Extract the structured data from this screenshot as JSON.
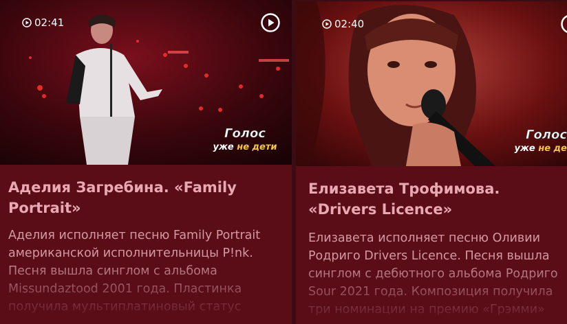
{
  "cards": [
    {
      "duration": "02:41",
      "title": "Аделия Загребина. «Family Portrait»",
      "description": "Аделия исполняет песню Family Portrait американской исполнительницы P!nk. Песня вышла синглом с альбома Missundaztood 2001 года. Пластинка получила мультиплатиновый статус",
      "logo_line1": "Голос",
      "logo_line2a": "уже ",
      "logo_line2b": "не дети"
    },
    {
      "duration": "02:40",
      "title": "Елизавета Трофимова. «Drivers Licence»",
      "description": "Елизавета исполняет песню Оливии Родриго Drivers Licence. Песня вышла синглом с дебютного альбома Родриго Sour 2021 года. Композиция получила три номинации на премию «Грэмми»",
      "logo_line1": "Голос",
      "logo_line2a": "уже ",
      "logo_line2b": "не дети"
    }
  ],
  "colors": {
    "card_bg": "#5a0d17",
    "title": "#e9a9b3",
    "text": "#d49aa3",
    "page_bg": "#3a0c14"
  }
}
